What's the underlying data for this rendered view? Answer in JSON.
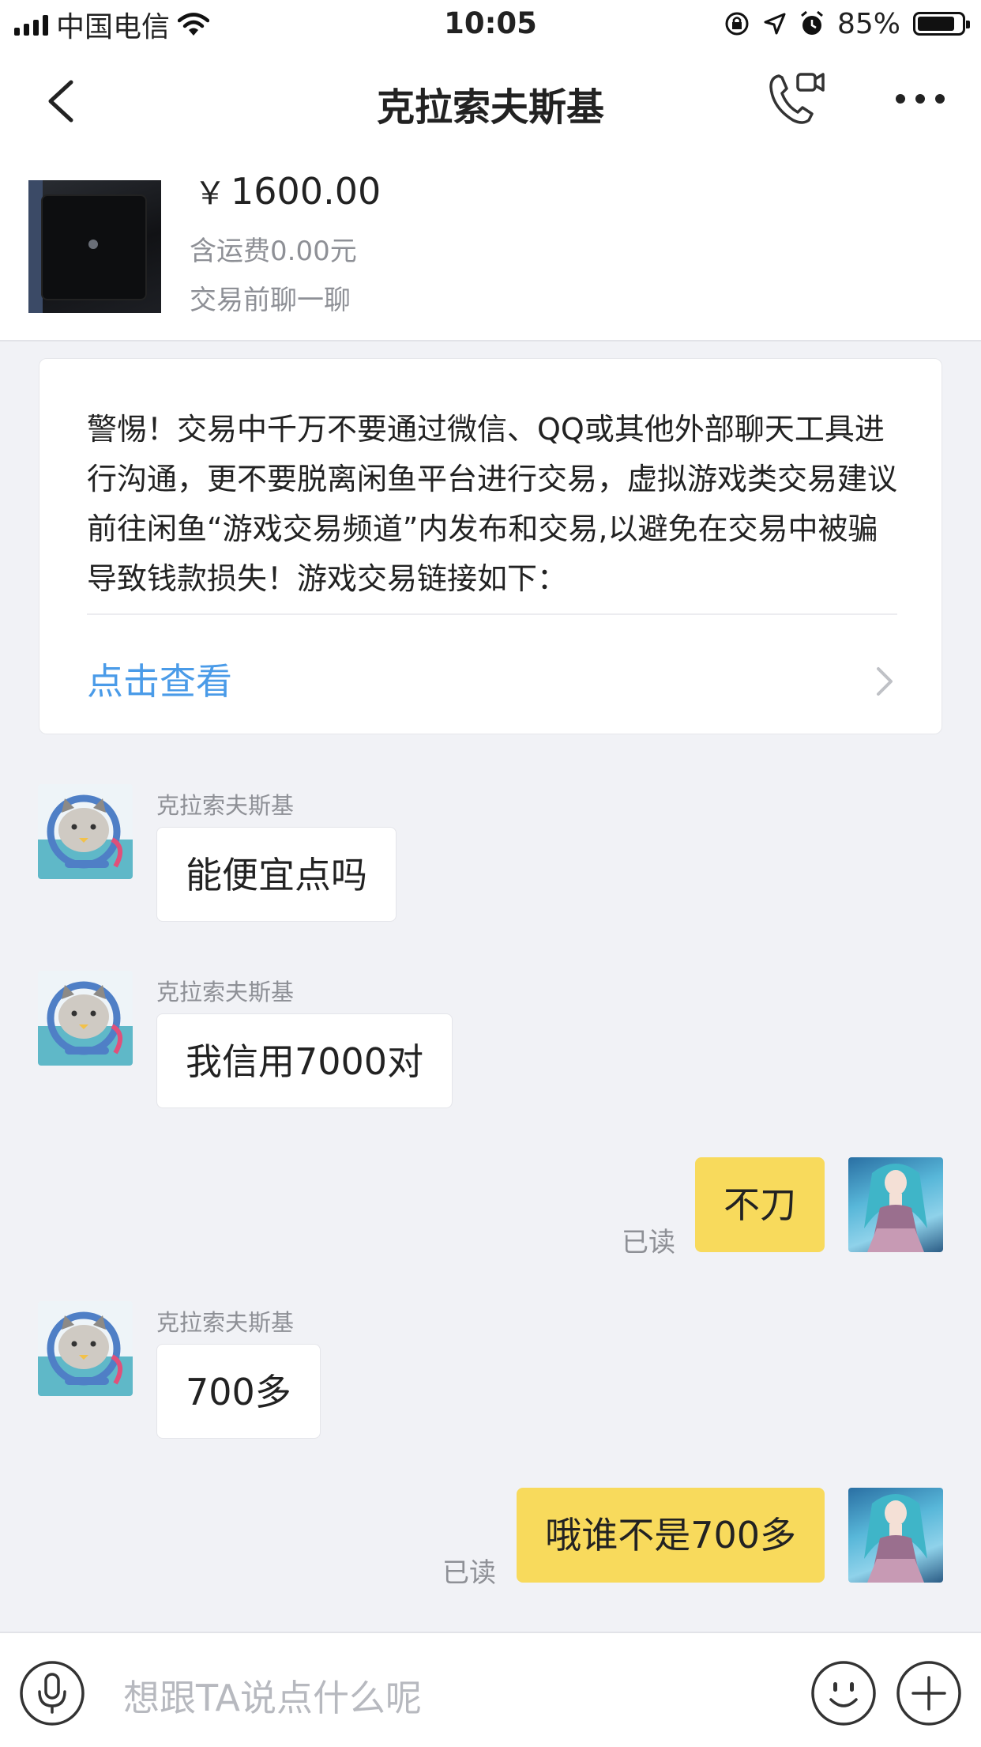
{
  "status_bar": {
    "carrier": "中国电信",
    "time": "10:05",
    "battery_text": "85%",
    "battery_level": 0.85,
    "icons": [
      "signal-icon",
      "wifi-icon",
      "orientation-lock-icon",
      "location-icon",
      "alarm-icon",
      "battery-icon"
    ]
  },
  "nav": {
    "title": "克拉索夫斯基",
    "icons": [
      "back-icon",
      "video-call-icon",
      "more-icon"
    ]
  },
  "product": {
    "currency": "￥",
    "price": "1600.00",
    "shipping": "含运费0.00元",
    "chat_hint": "交易前聊一聊"
  },
  "notice": {
    "text": "警惕！交易中千万不要通过微信、QQ或其他外部聊天工具进行沟通，更不要脱离闲鱼平台进行交易，虚拟游戏类交易建议前往闲鱼“游戏交易频道”内发布和交易,以避免在交易中被骗导致钱款损失！游戏交易链接如下：",
    "link_label": "点击查看"
  },
  "messages": [
    {
      "from": "other",
      "sender": "克拉索夫斯基",
      "text": "能便宜点吗"
    },
    {
      "from": "other",
      "sender": "克拉索夫斯基",
      "text": "我信用7000对"
    },
    {
      "from": "me",
      "text": "不刀",
      "status": "已读"
    },
    {
      "from": "other",
      "sender": "克拉索夫斯基",
      "text": "700多"
    },
    {
      "from": "me",
      "text": "哦谁不是700多",
      "status": "已读"
    }
  ],
  "input": {
    "placeholder": "想跟TA说点什么呢"
  },
  "colors": {
    "outgoing_bubble": "#f8da5c",
    "link": "#4a9be8",
    "background": "#f1f2f6"
  }
}
